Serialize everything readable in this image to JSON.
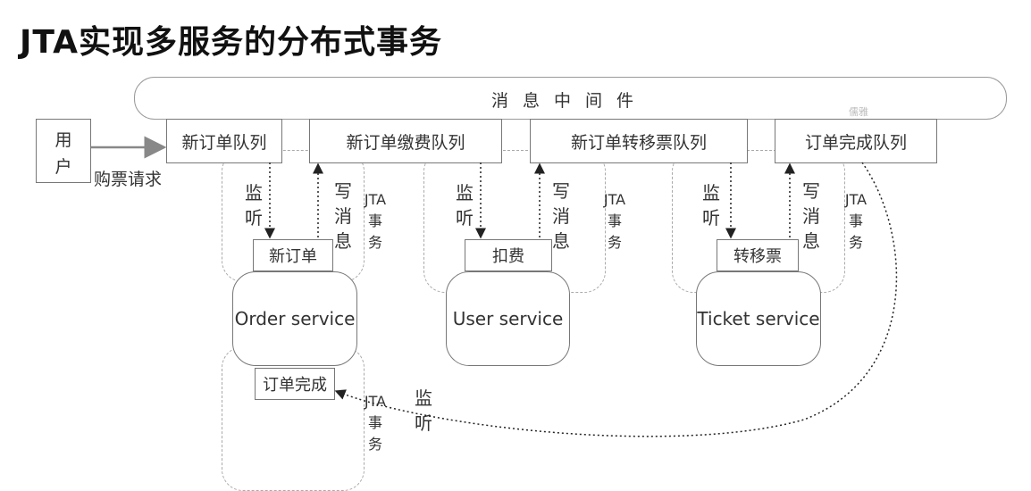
{
  "title": "JTA实现多服务的分布式事务",
  "message_middleware": "消息中间件",
  "watermark": "儒雅",
  "user": {
    "line1": "用",
    "line2": "户"
  },
  "request_label": "购票请求",
  "queues": {
    "new_order": "新订单队列",
    "order_payment": "新订单缴费队列",
    "order_transfer": "新订单转移票队列",
    "order_complete": "订单完成队列"
  },
  "labels": {
    "listen": [
      "监",
      "听"
    ],
    "write_msg": [
      "写",
      "消",
      "息"
    ],
    "jta_tx": [
      "JTA",
      "事",
      "务"
    ]
  },
  "services": {
    "order": {
      "task": "新订单",
      "name": "Order service",
      "task2": "订单完成"
    },
    "user": {
      "task": "扣费",
      "name": "User service"
    },
    "ticket": {
      "task": "转移票",
      "name": "Ticket service"
    }
  }
}
